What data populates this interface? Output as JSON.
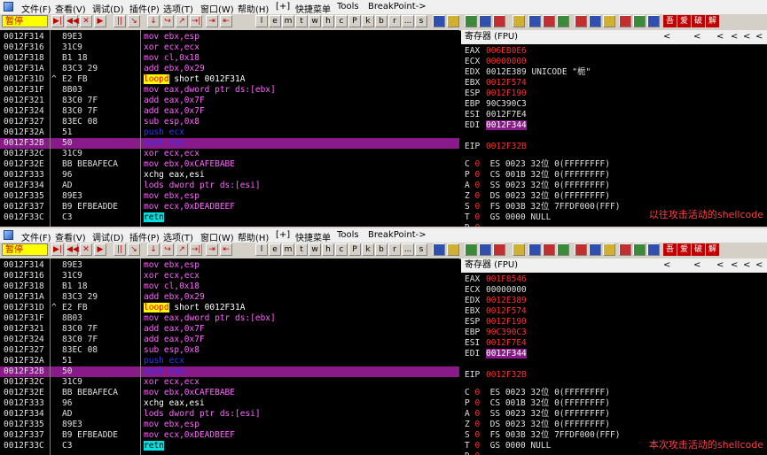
{
  "menu": [
    "文件(F)",
    "查看(V)",
    "调试(D)",
    "插件(P)",
    "选项(T)",
    "窗口(W)",
    "帮助(H)",
    "[+]",
    "快捷菜单",
    "Tools",
    "BreakPoint->"
  ],
  "status": "暂停",
  "toolbar_letters": [
    "l",
    "e",
    "m",
    "t",
    "w",
    "h",
    "c",
    "P",
    "k",
    "b",
    "r",
    "...",
    "s"
  ],
  "toolbar_cjk": [
    "吾",
    "爱",
    "破",
    "解"
  ],
  "reg_title": "寄存器 (FPU)",
  "arrows": [
    "<",
    "<",
    "<",
    "<",
    "<",
    "<"
  ],
  "panes": [
    {
      "caption": "以往攻击活动的shellcode",
      "code": [
        {
          "addr": "0012F314",
          "mark": "",
          "hex": "89E3",
          "mn": "mov",
          "ops": "ebx,esp",
          "cls": "mov"
        },
        {
          "addr": "0012F316",
          "mark": "",
          "hex": "31C9",
          "mn": "xor",
          "ops": "ecx,ecx",
          "cls": "xor"
        },
        {
          "addr": "0012F318",
          "mark": "",
          "hex": "B1 18",
          "mn": "mov",
          "ops": "cl,0x18",
          "cls": "mov"
        },
        {
          "addr": "0012F31A",
          "mark": "",
          "hex": "83C3 29",
          "mn": "add",
          "ops": "ebx,0x29",
          "cls": "add"
        },
        {
          "addr": "0012F31D",
          "mark": "^",
          "hex": "E2 FB",
          "mn": "loopd",
          "ops": "short 0012F31A",
          "cls": "loopd"
        },
        {
          "addr": "0012F31F",
          "mark": "",
          "hex": "8B03",
          "mn": "mov",
          "ops": "eax,dword ptr ds:[ebx]",
          "cls": "mov"
        },
        {
          "addr": "0012F321",
          "mark": "",
          "hex": "83C0 7F",
          "mn": "add",
          "ops": "eax,0x7F",
          "cls": "add"
        },
        {
          "addr": "0012F324",
          "mark": "",
          "hex": "83C0 7F",
          "mn": "add",
          "ops": "eax,0x7F",
          "cls": "add"
        },
        {
          "addr": "0012F327",
          "mark": "",
          "hex": "83EC 08",
          "mn": "sub",
          "ops": "esp,0x8",
          "cls": "sub"
        },
        {
          "addr": "0012F32A",
          "mark": "",
          "hex": "51",
          "mn": "push",
          "ops": "ecx",
          "cls": "push"
        },
        {
          "addr": "0012F32B",
          "mark": "",
          "hex": "50",
          "mn": "push",
          "ops": "eax",
          "cls": "push",
          "sel": true
        },
        {
          "addr": "0012F32C",
          "mark": "",
          "hex": "31C9",
          "mn": "xor",
          "ops": "ecx,ecx",
          "cls": "xor"
        },
        {
          "addr": "0012F32E",
          "mark": "",
          "hex": "BB BEBAFECA",
          "mn": "mov",
          "ops": "ebx,0xCAFEBABE",
          "cls": "mov"
        },
        {
          "addr": "0012F333",
          "mark": "",
          "hex": "96",
          "mn": "xchg",
          "ops": "eax,esi",
          "cls": "xchg"
        },
        {
          "addr": "0012F334",
          "mark": "",
          "hex": "AD",
          "mn": "lods",
          "ops": "dword ptr ds:[esi]",
          "cls": "lods"
        },
        {
          "addr": "0012F335",
          "mark": "",
          "hex": "89E3",
          "mn": "mov",
          "ops": "ebx,esp",
          "cls": "mov"
        },
        {
          "addr": "0012F337",
          "mark": "",
          "hex": "B9 EFBEADDE",
          "mn": "mov",
          "ops": "ecx,0xDEADBEEF",
          "cls": "mov"
        },
        {
          "addr": "0012F33C",
          "mark": "",
          "hex": "C3",
          "mn": "retn",
          "ops": "",
          "cls": "retn"
        }
      ],
      "regs": [
        {
          "n": "EAX",
          "v": "006EB0E6",
          "st": "r"
        },
        {
          "n": "ECX",
          "v": "00000000",
          "st": "r"
        },
        {
          "n": "EDX",
          "v": "0012E389",
          "st": "w",
          "extra": "UNICODE \"栀\""
        },
        {
          "n": "EBX",
          "v": "0012F574",
          "st": "r"
        },
        {
          "n": "ESP",
          "v": "0012F190",
          "st": "r"
        },
        {
          "n": "EBP",
          "v": "90C390C3",
          "st": "w"
        },
        {
          "n": "ESI",
          "v": "0012F7E4",
          "st": "w"
        },
        {
          "n": "EDI",
          "v": "0012F344",
          "st": "hl"
        }
      ],
      "eip": {
        "n": "EIP",
        "v": "0012F32B"
      },
      "flags": [
        {
          "f": "C",
          "v": "0",
          "seg": "ES 0023 32位 0(FFFFFFFF)"
        },
        {
          "f": "P",
          "v": "0",
          "seg": "CS 001B 32位 0(FFFFFFFF)"
        },
        {
          "f": "A",
          "v": "0",
          "seg": "SS 0023 32位 0(FFFFFFFF)"
        },
        {
          "f": "Z",
          "v": "0",
          "seg": "DS 0023 32位 0(FFFFFFFF)"
        },
        {
          "f": "S",
          "v": "0",
          "seg": "FS 003B 32位 7FFDF000(FFF)"
        },
        {
          "f": "T",
          "v": "0",
          "seg": "GS 0000 NULL"
        },
        {
          "f": "D",
          "v": "0",
          "seg": ""
        }
      ]
    },
    {
      "caption": "本次攻击活动的shellcode",
      "code": [
        {
          "addr": "0012F314",
          "mark": "",
          "hex": "89E3",
          "mn": "mov",
          "ops": "ebx,esp",
          "cls": "mov"
        },
        {
          "addr": "0012F316",
          "mark": "",
          "hex": "31C9",
          "mn": "xor",
          "ops": "ecx,ecx",
          "cls": "xor"
        },
        {
          "addr": "0012F318",
          "mark": "",
          "hex": "B1 18",
          "mn": "mov",
          "ops": "cl,0x18",
          "cls": "mov"
        },
        {
          "addr": "0012F31A",
          "mark": "",
          "hex": "83C3 29",
          "mn": "add",
          "ops": "ebx,0x29",
          "cls": "add"
        },
        {
          "addr": "0012F31D",
          "mark": "^",
          "hex": "E2 FB",
          "mn": "loopd",
          "ops": "short 0012F31A",
          "cls": "loopd"
        },
        {
          "addr": "0012F31F",
          "mark": "",
          "hex": "8B03",
          "mn": "mov",
          "ops": "eax,dword ptr ds:[ebx]",
          "cls": "mov"
        },
        {
          "addr": "0012F321",
          "mark": "",
          "hex": "83C0 7F",
          "mn": "add",
          "ops": "eax,0x7F",
          "cls": "add"
        },
        {
          "addr": "0012F324",
          "mark": "",
          "hex": "83C0 7F",
          "mn": "add",
          "ops": "eax,0x7F",
          "cls": "add"
        },
        {
          "addr": "0012F327",
          "mark": "",
          "hex": "83EC 08",
          "mn": "sub",
          "ops": "esp,0x8",
          "cls": "sub"
        },
        {
          "addr": "0012F32A",
          "mark": "",
          "hex": "51",
          "mn": "push",
          "ops": "ecx",
          "cls": "push"
        },
        {
          "addr": "0012F32B",
          "mark": "",
          "hex": "50",
          "mn": "push",
          "ops": "eax",
          "cls": "push",
          "sel": true
        },
        {
          "addr": "0012F32C",
          "mark": "",
          "hex": "31C9",
          "mn": "xor",
          "ops": "ecx,ecx",
          "cls": "xor"
        },
        {
          "addr": "0012F32E",
          "mark": "",
          "hex": "BB BEBAFECA",
          "mn": "mov",
          "ops": "ebx,0xCAFEBABE",
          "cls": "mov"
        },
        {
          "addr": "0012F333",
          "mark": "",
          "hex": "96",
          "mn": "xchg",
          "ops": "eax,esi",
          "cls": "xchg"
        },
        {
          "addr": "0012F334",
          "mark": "",
          "hex": "AD",
          "mn": "lods",
          "ops": "dword ptr ds:[esi]",
          "cls": "lods"
        },
        {
          "addr": "0012F335",
          "mark": "",
          "hex": "89E3",
          "mn": "mov",
          "ops": "ebx,esp",
          "cls": "mov"
        },
        {
          "addr": "0012F337",
          "mark": "",
          "hex": "B9 EFBEADDE",
          "mn": "mov",
          "ops": "ecx,0xDEADBEEF",
          "cls": "mov"
        },
        {
          "addr": "0012F33C",
          "mark": "",
          "hex": "C3",
          "mn": "retn",
          "ops": "",
          "cls": "retn"
        }
      ],
      "regs": [
        {
          "n": "EAX",
          "v": "001F8546",
          "st": "r"
        },
        {
          "n": "ECX",
          "v": "00000000",
          "st": "w"
        },
        {
          "n": "EDX",
          "v": "0012E389",
          "st": "r"
        },
        {
          "n": "EBX",
          "v": "0012F574",
          "st": "r"
        },
        {
          "n": "ESP",
          "v": "0012F190",
          "st": "r"
        },
        {
          "n": "EBP",
          "v": "90C390C3",
          "st": "r"
        },
        {
          "n": "ESI",
          "v": "0012F7E4",
          "st": "r"
        },
        {
          "n": "EDI",
          "v": "0012F344",
          "st": "hl"
        }
      ],
      "eip": {
        "n": "EIP",
        "v": "0012F32B"
      },
      "flags": [
        {
          "f": "C",
          "v": "0",
          "seg": "ES 0023 32位 0(FFFFFFFF)"
        },
        {
          "f": "P",
          "v": "0",
          "seg": "CS 001B 32位 0(FFFFFFFF)"
        },
        {
          "f": "A",
          "v": "0",
          "seg": "SS 0023 32位 0(FFFFFFFF)"
        },
        {
          "f": "Z",
          "v": "0",
          "seg": "DS 0023 32位 0(FFFFFFFF)"
        },
        {
          "f": "S",
          "v": "0",
          "seg": "FS 003B 32位 7FFDF000(FFF)"
        },
        {
          "f": "T",
          "v": "0",
          "seg": "GS 0000 NULL"
        },
        {
          "f": "D",
          "v": "0",
          "seg": ""
        }
      ]
    }
  ]
}
